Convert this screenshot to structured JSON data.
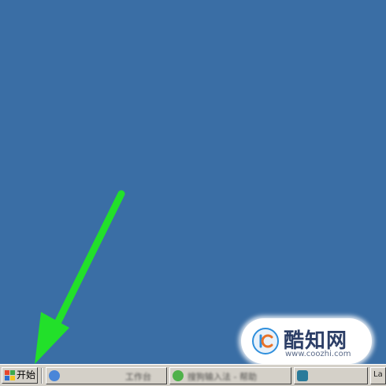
{
  "taskbar": {
    "start_label": "开始",
    "tasks": [
      {
        "label": "工作台",
        "icon": "browser-icon"
      },
      {
        "label": "搜狗输入法 - 帮助",
        "icon": "app-icon"
      },
      {
        "label": "",
        "icon": "window-icon"
      },
      {
        "label": "La",
        "icon": ""
      }
    ]
  },
  "watermark": {
    "title": "酷知网",
    "url": "www.coozhi.com"
  },
  "annotation": {
    "arrow_color": "#22e02a"
  },
  "colors": {
    "desktop": "#3a6ea5",
    "taskbar": "#d4d0c8"
  }
}
